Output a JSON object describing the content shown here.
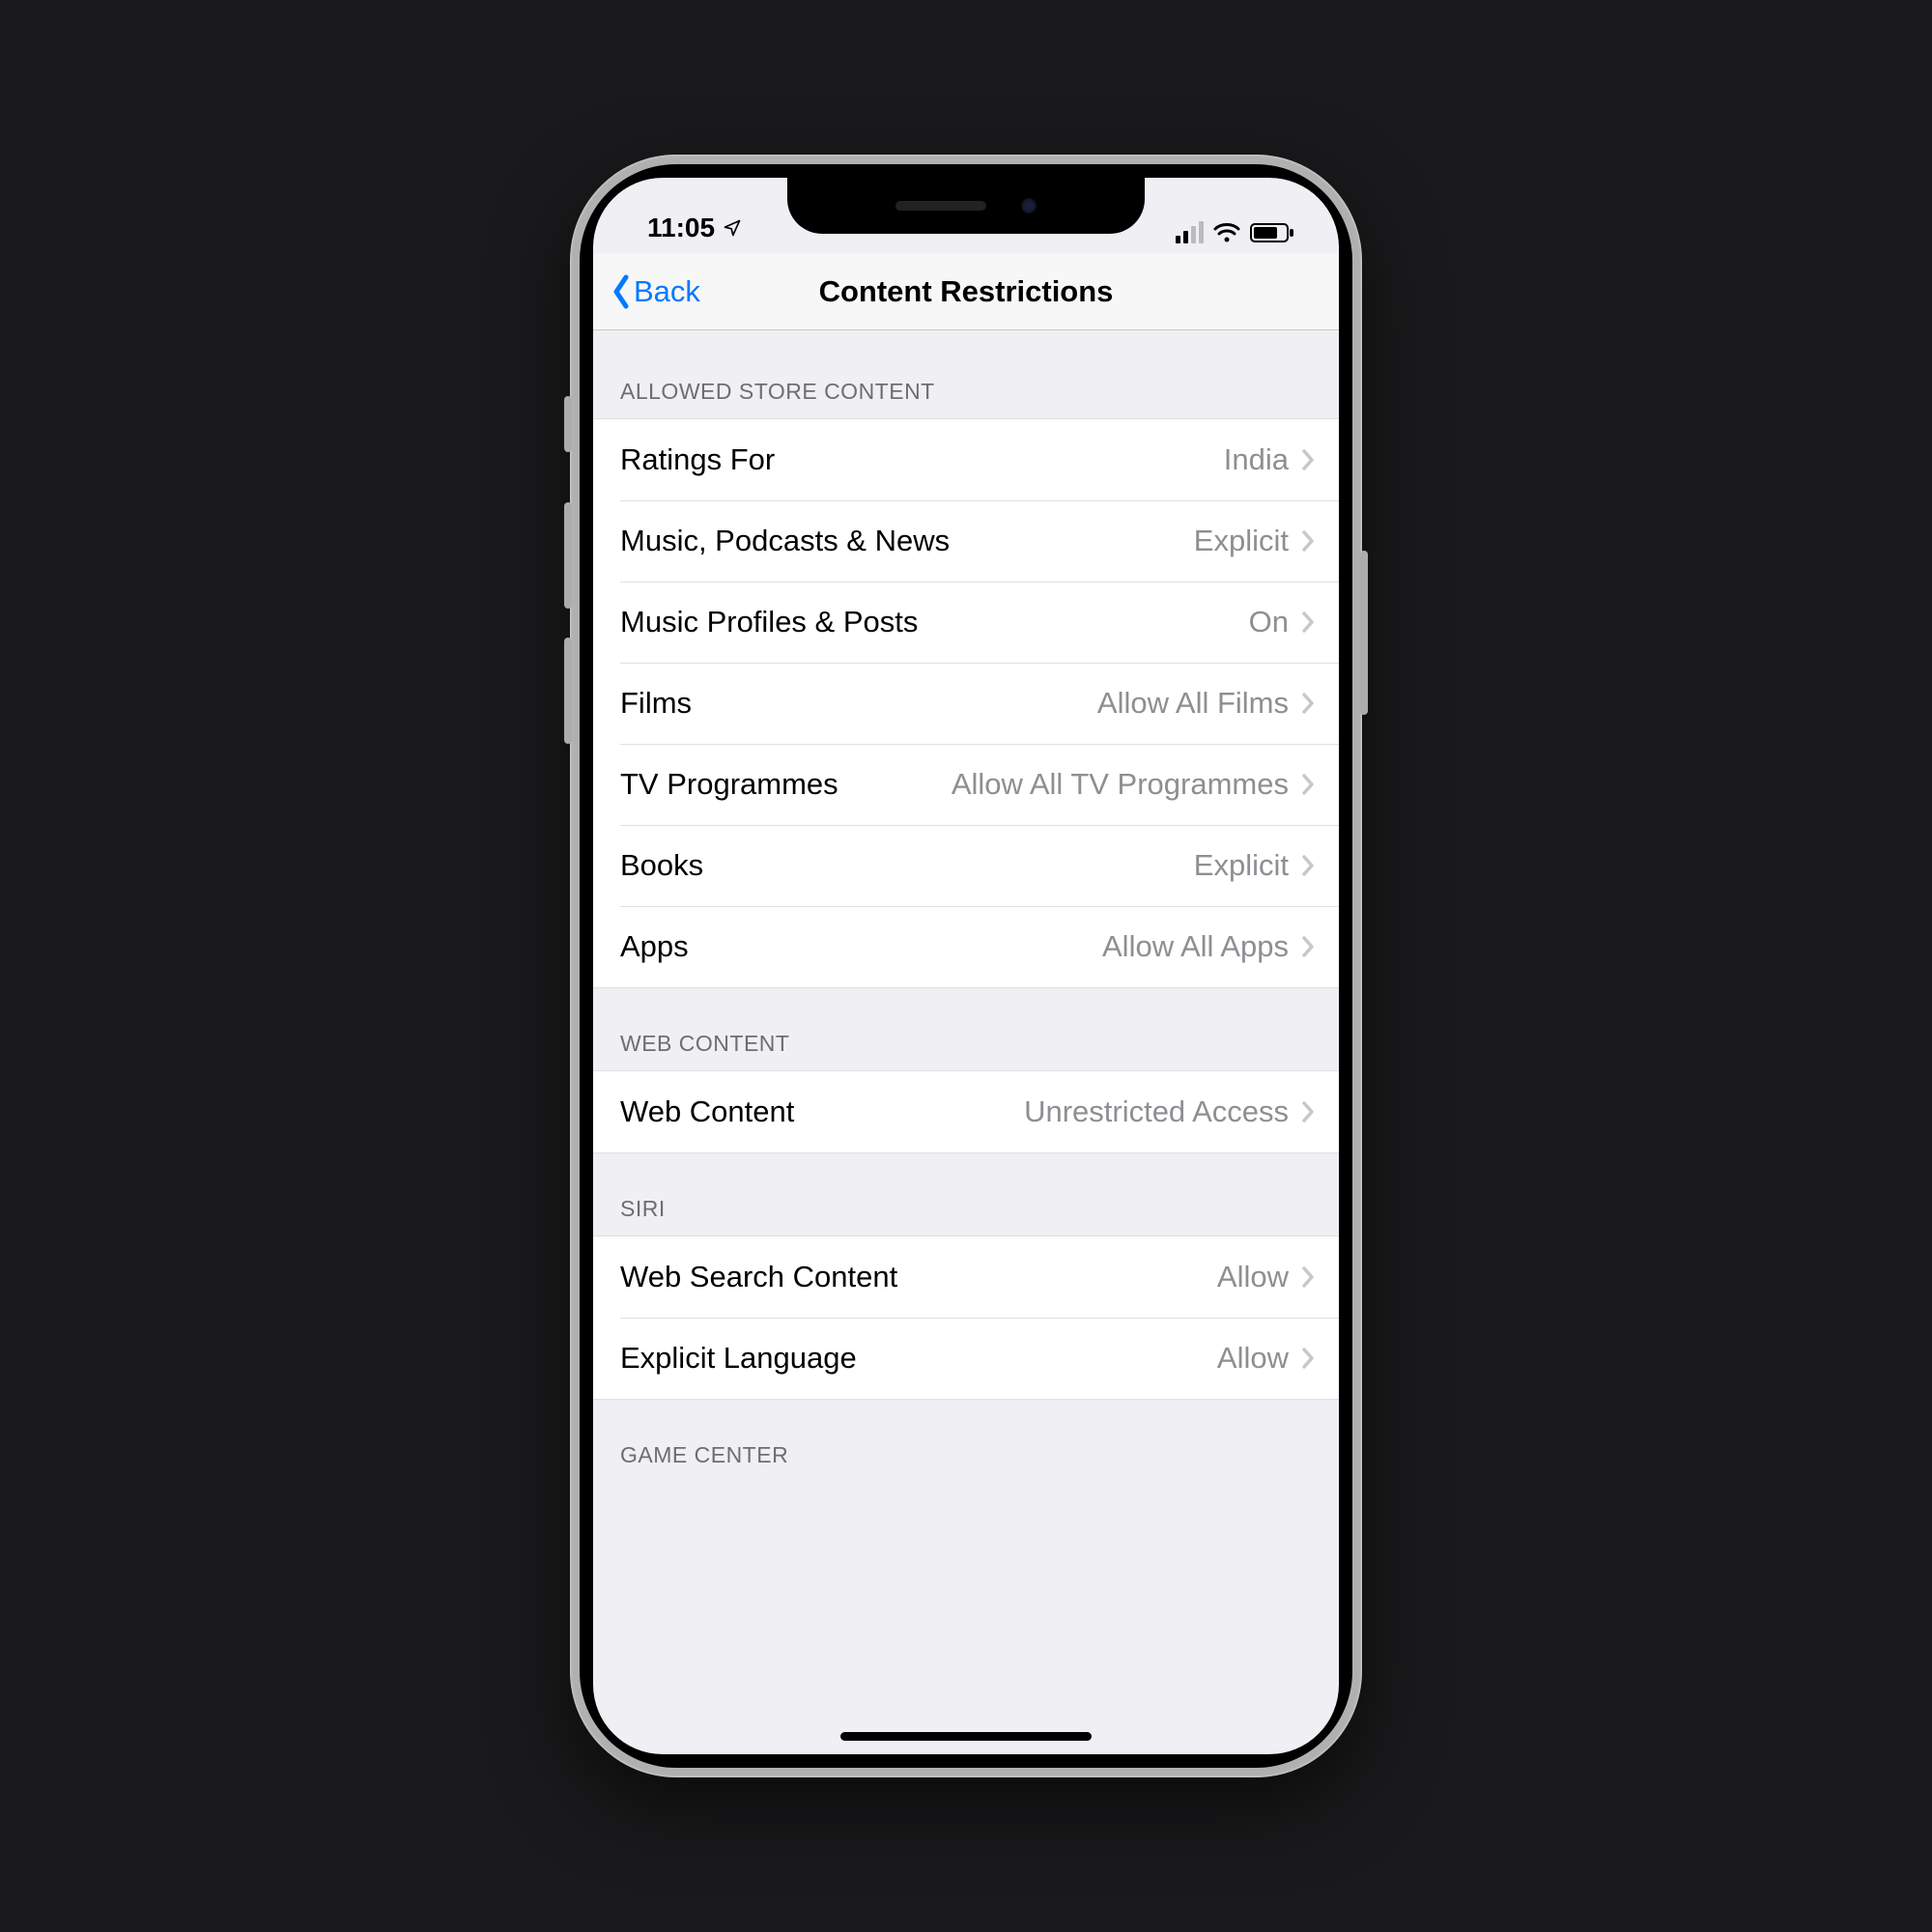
{
  "status": {
    "time": "11:05"
  },
  "nav": {
    "back_label": "Back",
    "title": "Content Restrictions"
  },
  "sections": {
    "allowed_store": {
      "header": "ALLOWED STORE CONTENT",
      "items": [
        {
          "label": "Ratings For",
          "value": "India"
        },
        {
          "label": "Music, Podcasts & News",
          "value": "Explicit"
        },
        {
          "label": "Music Profiles & Posts",
          "value": "On"
        },
        {
          "label": "Films",
          "value": "Allow All Films"
        },
        {
          "label": "TV Programmes",
          "value": "Allow All TV Programmes"
        },
        {
          "label": "Books",
          "value": "Explicit"
        },
        {
          "label": "Apps",
          "value": "Allow All Apps"
        }
      ]
    },
    "web_content": {
      "header": "WEB CONTENT",
      "items": [
        {
          "label": "Web Content",
          "value": "Unrestricted Access"
        }
      ]
    },
    "siri": {
      "header": "SIRI",
      "items": [
        {
          "label": "Web Search Content",
          "value": "Allow"
        },
        {
          "label": "Explicit Language",
          "value": "Allow"
        }
      ]
    },
    "game_center": {
      "header": "GAME CENTER"
    }
  }
}
